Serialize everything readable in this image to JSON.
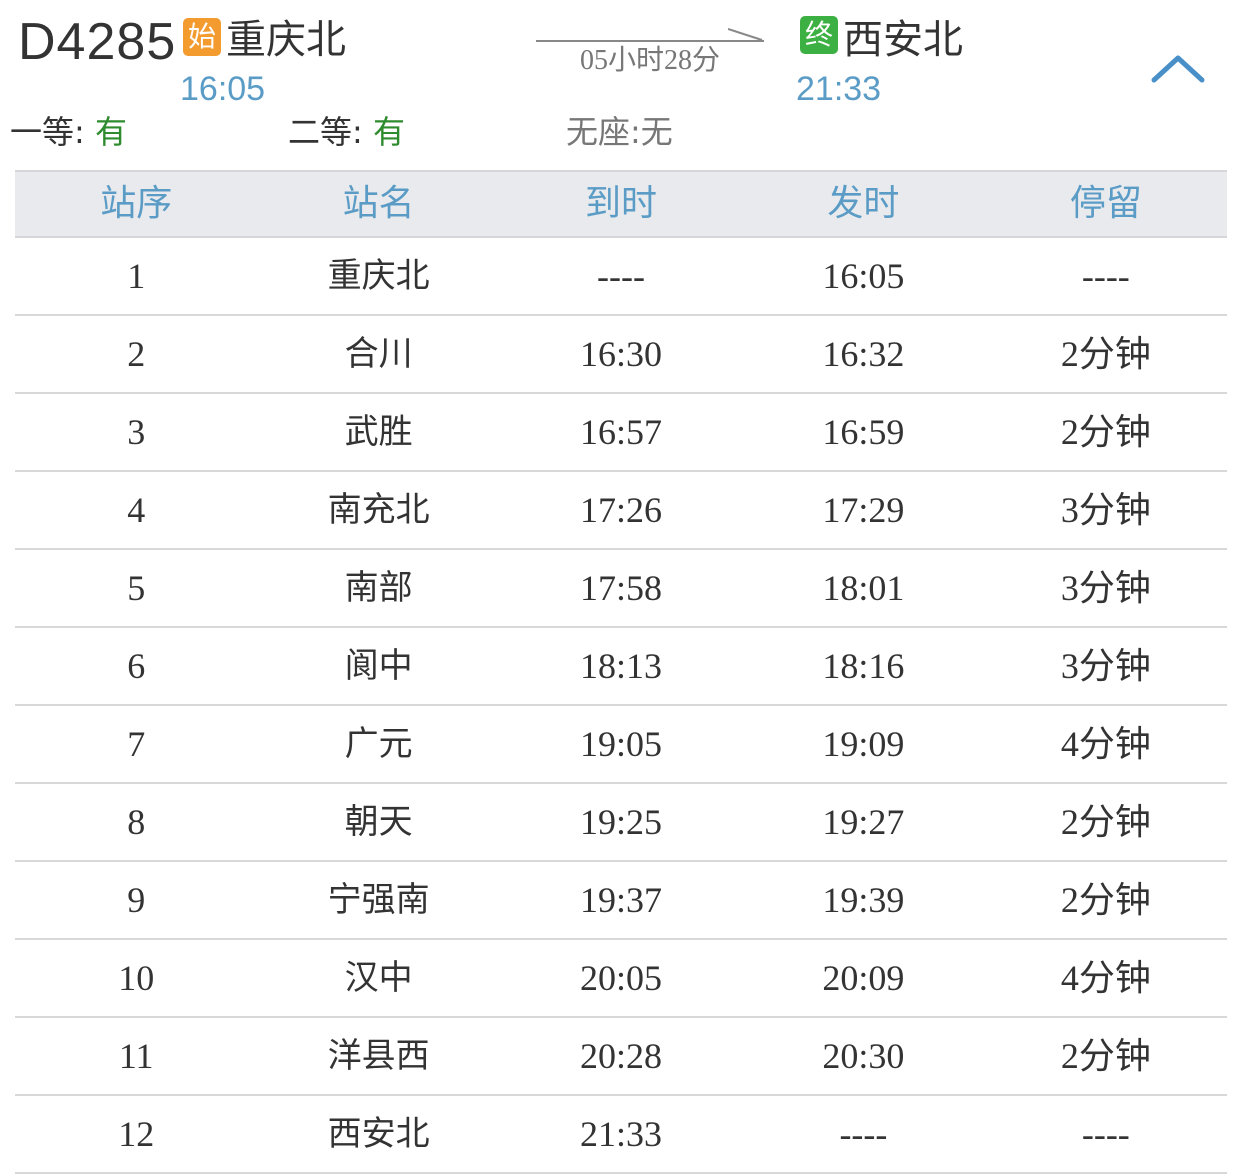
{
  "train": {
    "number": "D4285",
    "start_badge": "始",
    "end_badge": "终",
    "from_station": "重庆北",
    "to_station": "西安北",
    "departure_time": "16:05",
    "arrival_time": "21:33",
    "duration": "05小时28分"
  },
  "seats": {
    "first_class_label": "一等",
    "first_class_value": "有",
    "second_class_label": "二等",
    "second_class_value": "有",
    "no_seat": "无座:无"
  },
  "icons": {
    "collapse": "chevron-up-icon",
    "arrow": "arrow-right-icon"
  },
  "colors": {
    "time_blue": "#5b9cc6",
    "start_badge": "#f39b2f",
    "end_badge": "#3cb043",
    "available_green": "#2e8b2e",
    "header_bg": "#e8eaed"
  },
  "table": {
    "headers": [
      "站序",
      "站名",
      "到时",
      "发时",
      "停留"
    ],
    "rows": [
      [
        "1",
        "重庆北",
        "----",
        "16:05",
        "----"
      ],
      [
        "2",
        "合川",
        "16:30",
        "16:32",
        "2分钟"
      ],
      [
        "3",
        "武胜",
        "16:57",
        "16:59",
        "2分钟"
      ],
      [
        "4",
        "南充北",
        "17:26",
        "17:29",
        "3分钟"
      ],
      [
        "5",
        "南部",
        "17:58",
        "18:01",
        "3分钟"
      ],
      [
        "6",
        "阆中",
        "18:13",
        "18:16",
        "3分钟"
      ],
      [
        "7",
        "广元",
        "19:05",
        "19:09",
        "4分钟"
      ],
      [
        "8",
        "朝天",
        "19:25",
        "19:27",
        "2分钟"
      ],
      [
        "9",
        "宁强南",
        "19:37",
        "19:39",
        "2分钟"
      ],
      [
        "10",
        "汉中",
        "20:05",
        "20:09",
        "4分钟"
      ],
      [
        "11",
        "洋县西",
        "20:28",
        "20:30",
        "2分钟"
      ],
      [
        "12",
        "西安北",
        "21:33",
        "----",
        "----"
      ]
    ]
  }
}
